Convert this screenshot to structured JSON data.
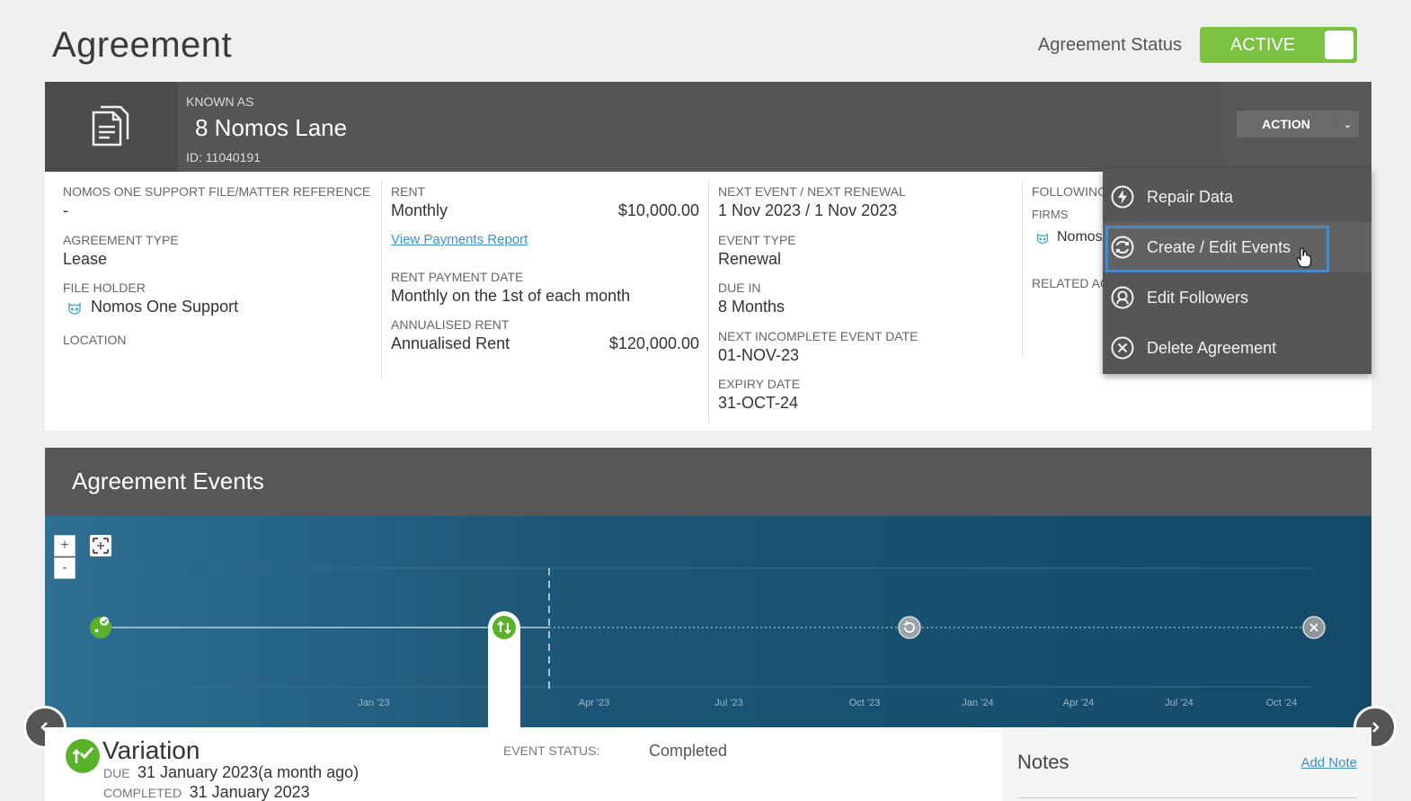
{
  "page": {
    "title": "Agreement"
  },
  "status": {
    "label": "Agreement Status",
    "value": "ACTIVE"
  },
  "header": {
    "known_as_label": "KNOWN AS",
    "name": "8 Nomos Lane",
    "id": "ID: 11040191",
    "action_label": "ACTION"
  },
  "details": {
    "ref_label": "NOMOS ONE SUPPORT FILE/MATTER REFERENCE",
    "ref_value": "-",
    "type_label": "AGREEMENT TYPE",
    "type_value": "Lease",
    "holder_label": "FILE HOLDER",
    "holder_value": "Nomos One Support",
    "location_label": "LOCATION",
    "rent_label": "RENT",
    "rent_freq": "Monthly",
    "rent_amount": "$10,000.00",
    "payments_link": "View Payments Report",
    "payment_date_label": "RENT PAYMENT DATE",
    "payment_date_value": "Monthly on the 1st of each month",
    "annualised_label": "ANNUALISED RENT",
    "annualised_name": "Annualised Rent",
    "annualised_amount": "$120,000.00",
    "next_event_label": "NEXT EVENT / NEXT RENEWAL",
    "next_event_value": "1 Nov 2023 / 1 Nov 2023",
    "event_type_label": "EVENT TYPE",
    "event_type_value": "Renewal",
    "due_in_label": "DUE IN",
    "due_in_value": "8 Months",
    "next_incomplete_label": "NEXT INCOMPLETE EVENT DATE",
    "next_incomplete_value": "01-NOV-23",
    "expiry_label": "EXPIRY DATE",
    "expiry_value": "31-OCT-24",
    "following_label": "FOLLOWING",
    "firms_label": "FIRMS",
    "firms_value": "Nomos",
    "related_label": "RELATED AG"
  },
  "action_menu": {
    "items": [
      {
        "label": "Repair Data",
        "icon": "bolt-icon"
      },
      {
        "label": "Create / Edit Events",
        "icon": "sync-icon"
      },
      {
        "label": "Edit Followers",
        "icon": "follower-icon"
      },
      {
        "label": "Delete Agreement",
        "icon": "close-circle-icon"
      }
    ]
  },
  "events": {
    "title": "Agreement Events",
    "zoom_in": "+",
    "zoom_out": "-",
    "ticks": [
      "Jan '23",
      "Apr '23",
      "Jul '23",
      "Oct '23",
      "Jan '24",
      "Apr '24",
      "Jul '24",
      "Oct '24"
    ]
  },
  "event_detail": {
    "name": "Variation",
    "due_label": "DUE",
    "due_value": "31 January 2023(a month ago)",
    "completed_label": "COMPLETED",
    "completed_value": "31 January 2023",
    "status_label": "EVENT STATUS:",
    "status_value": "Completed"
  },
  "notes": {
    "title": "Notes",
    "add_label": "Add Note"
  },
  "colors": {
    "accent_green": "#7cc242",
    "link_blue": "#3a8fd0",
    "highlight": "#4a88c8"
  }
}
